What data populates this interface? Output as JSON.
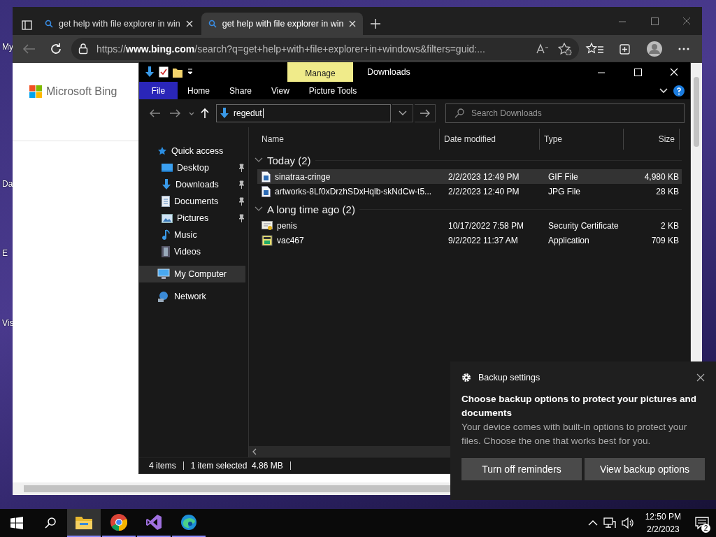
{
  "desktop_icons": [
    {
      "label": "My"
    },
    {
      "label": "Da"
    },
    {
      "label": "E"
    },
    {
      "label": "Vis"
    }
  ],
  "browser": {
    "tabs": [
      {
        "title": "get help with file explorer in win",
        "selected": false
      },
      {
        "title": "get help with file explorer in win",
        "selected": true
      }
    ],
    "url": {
      "scheme": "https://",
      "host": "www.bing.com",
      "path": "/search?q=get+help+with+file+explorer+in+windows&filters=guid:..."
    },
    "page": {
      "logo_text": "Microsoft Bing"
    }
  },
  "explorer": {
    "title": "Downloads",
    "context_tab": "Manage",
    "ribbon_tabs": [
      {
        "label": "File",
        "kind": "file"
      },
      {
        "label": "Home",
        "kind": "tab"
      },
      {
        "label": "Share",
        "kind": "tab"
      },
      {
        "label": "View",
        "kind": "tab"
      },
      {
        "label": "Picture Tools",
        "kind": "context"
      }
    ],
    "address": {
      "value": "regedut"
    },
    "search": {
      "placeholder": "Search Downloads"
    },
    "nav": [
      {
        "label": "Quick access",
        "kind": "star",
        "selected": false,
        "children": [
          {
            "label": "Desktop",
            "kind": "desktop",
            "pinned": true,
            "selected": false
          },
          {
            "label": "Downloads",
            "kind": "download",
            "pinned": true,
            "selected": false
          },
          {
            "label": "Documents",
            "kind": "document",
            "pinned": true,
            "selected": false
          },
          {
            "label": "Pictures",
            "kind": "picture",
            "pinned": true,
            "selected": false
          },
          {
            "label": "Music",
            "kind": "music",
            "pinned": false,
            "selected": false
          },
          {
            "label": "Videos",
            "kind": "video",
            "pinned": false,
            "selected": false
          }
        ]
      },
      {
        "label": "My Computer",
        "kind": "computer",
        "selected": true
      },
      {
        "label": "Network",
        "kind": "network",
        "selected": false
      }
    ],
    "columns": [
      "Name",
      "Date modified",
      "Type",
      "Size"
    ],
    "groups": [
      {
        "title": "Today (2)",
        "expanded": true,
        "rows": [
          {
            "name": "sinatraa-cringe",
            "kind": "image",
            "date": "2/2/2023 12:49 PM",
            "type": "GIF File",
            "size": "4,980 KB",
            "selected": true
          },
          {
            "name": "artworks-8Lf0xDrzhSDxHqlb-skNdCw-t5...",
            "kind": "image",
            "date": "2/2/2023 12:40 PM",
            "type": "JPG File",
            "size": "28 KB",
            "selected": false
          }
        ]
      },
      {
        "title": "A long time ago (2)",
        "expanded": true,
        "rows": [
          {
            "name": "penis",
            "kind": "certificate",
            "date": "10/17/2022 7:58 PM",
            "type": "Security Certificate",
            "size": "2 KB",
            "selected": false
          },
          {
            "name": "vac467",
            "kind": "application",
            "date": "9/2/2022 11:37 AM",
            "type": "Application",
            "size": "709 KB",
            "selected": false
          }
        ]
      }
    ],
    "status": [
      "4 items",
      "1 item selected  4.86 MB"
    ]
  },
  "toast": {
    "app": "Backup settings",
    "title": "Choose backup options to protect your pictures and documents",
    "body": "Your device comes with built-in options to protect your files. Choose the one that works best for you.",
    "buttons": [
      "Turn off reminders",
      "View backup options"
    ]
  },
  "taskbar": {
    "apps": [
      {
        "kind": "folder",
        "active": true
      },
      {
        "kind": "chrome",
        "active": false
      },
      {
        "kind": "studio",
        "active": false
      },
      {
        "kind": "edge",
        "active": false
      }
    ],
    "time": "12:50 PM",
    "date": "2/2/2023",
    "notifications": "2"
  }
}
